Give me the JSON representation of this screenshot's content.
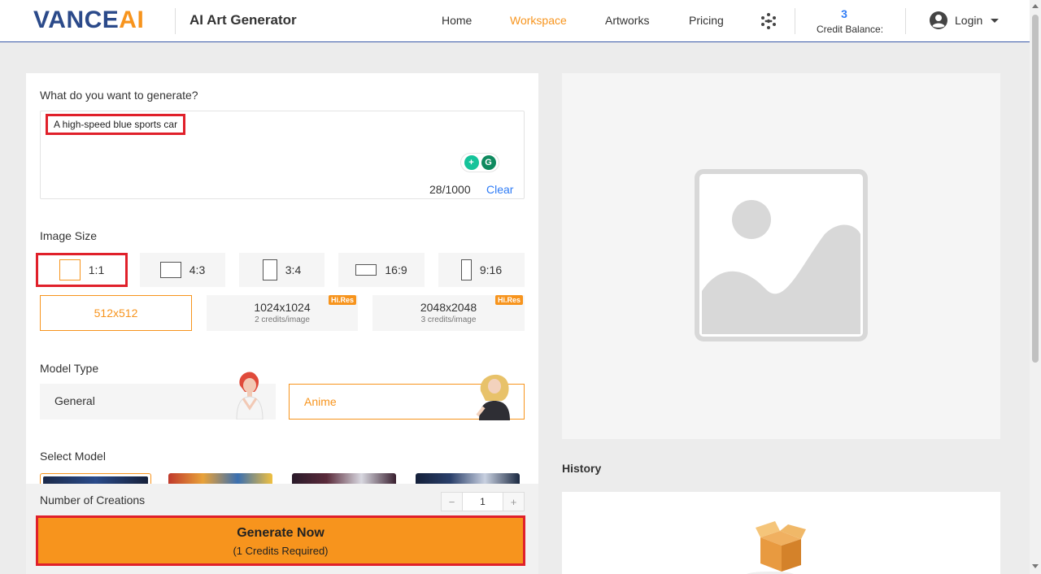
{
  "header": {
    "logo_main": "VANCE",
    "logo_accent": "AI",
    "product_name": "AI Art Generator",
    "nav": [
      "Home",
      "Workspace",
      "Artworks",
      "Pricing"
    ],
    "active_nav": "Workspace",
    "credit_balance_value": "3",
    "credit_balance_label": "Credit Balance:",
    "login_label": "Login",
    "accent_color": "#f7941d",
    "brand_color": "#2b4a8a"
  },
  "prompt": {
    "question": "What do you want to generate?",
    "value": "A high-speed blue sports car",
    "char_count": "28/1000",
    "clear_label": "Clear",
    "tool_icons": [
      "grammarly-plus-icon",
      "grammarly-g-icon"
    ]
  },
  "image_size": {
    "label": "Image Size",
    "ratios": [
      {
        "label": "1:1",
        "selected": true
      },
      {
        "label": "4:3",
        "selected": false
      },
      {
        "label": "3:4",
        "selected": false
      },
      {
        "label": "16:9",
        "selected": false
      },
      {
        "label": "9:16",
        "selected": false
      }
    ],
    "resolutions": [
      {
        "label": "512x512",
        "sub": "",
        "badge": "",
        "selected": true
      },
      {
        "label": "1024x1024",
        "sub": "2 credits/image",
        "badge": "Hi.Res",
        "selected": false
      },
      {
        "label": "2048x2048",
        "sub": "3 credits/image",
        "badge": "Hi.Res",
        "selected": false
      }
    ]
  },
  "model_type": {
    "label": "Model Type",
    "options": [
      {
        "label": "General",
        "selected": false
      },
      {
        "label": "Anime",
        "selected": true
      }
    ]
  },
  "select_model": {
    "label": "Select Model"
  },
  "creations": {
    "label": "Number of Creations",
    "value": "1",
    "minus": "−",
    "plus": "+"
  },
  "generate": {
    "title": "Generate Now",
    "subtitle": "(1 Credits Required)"
  },
  "history": {
    "title": "History"
  }
}
